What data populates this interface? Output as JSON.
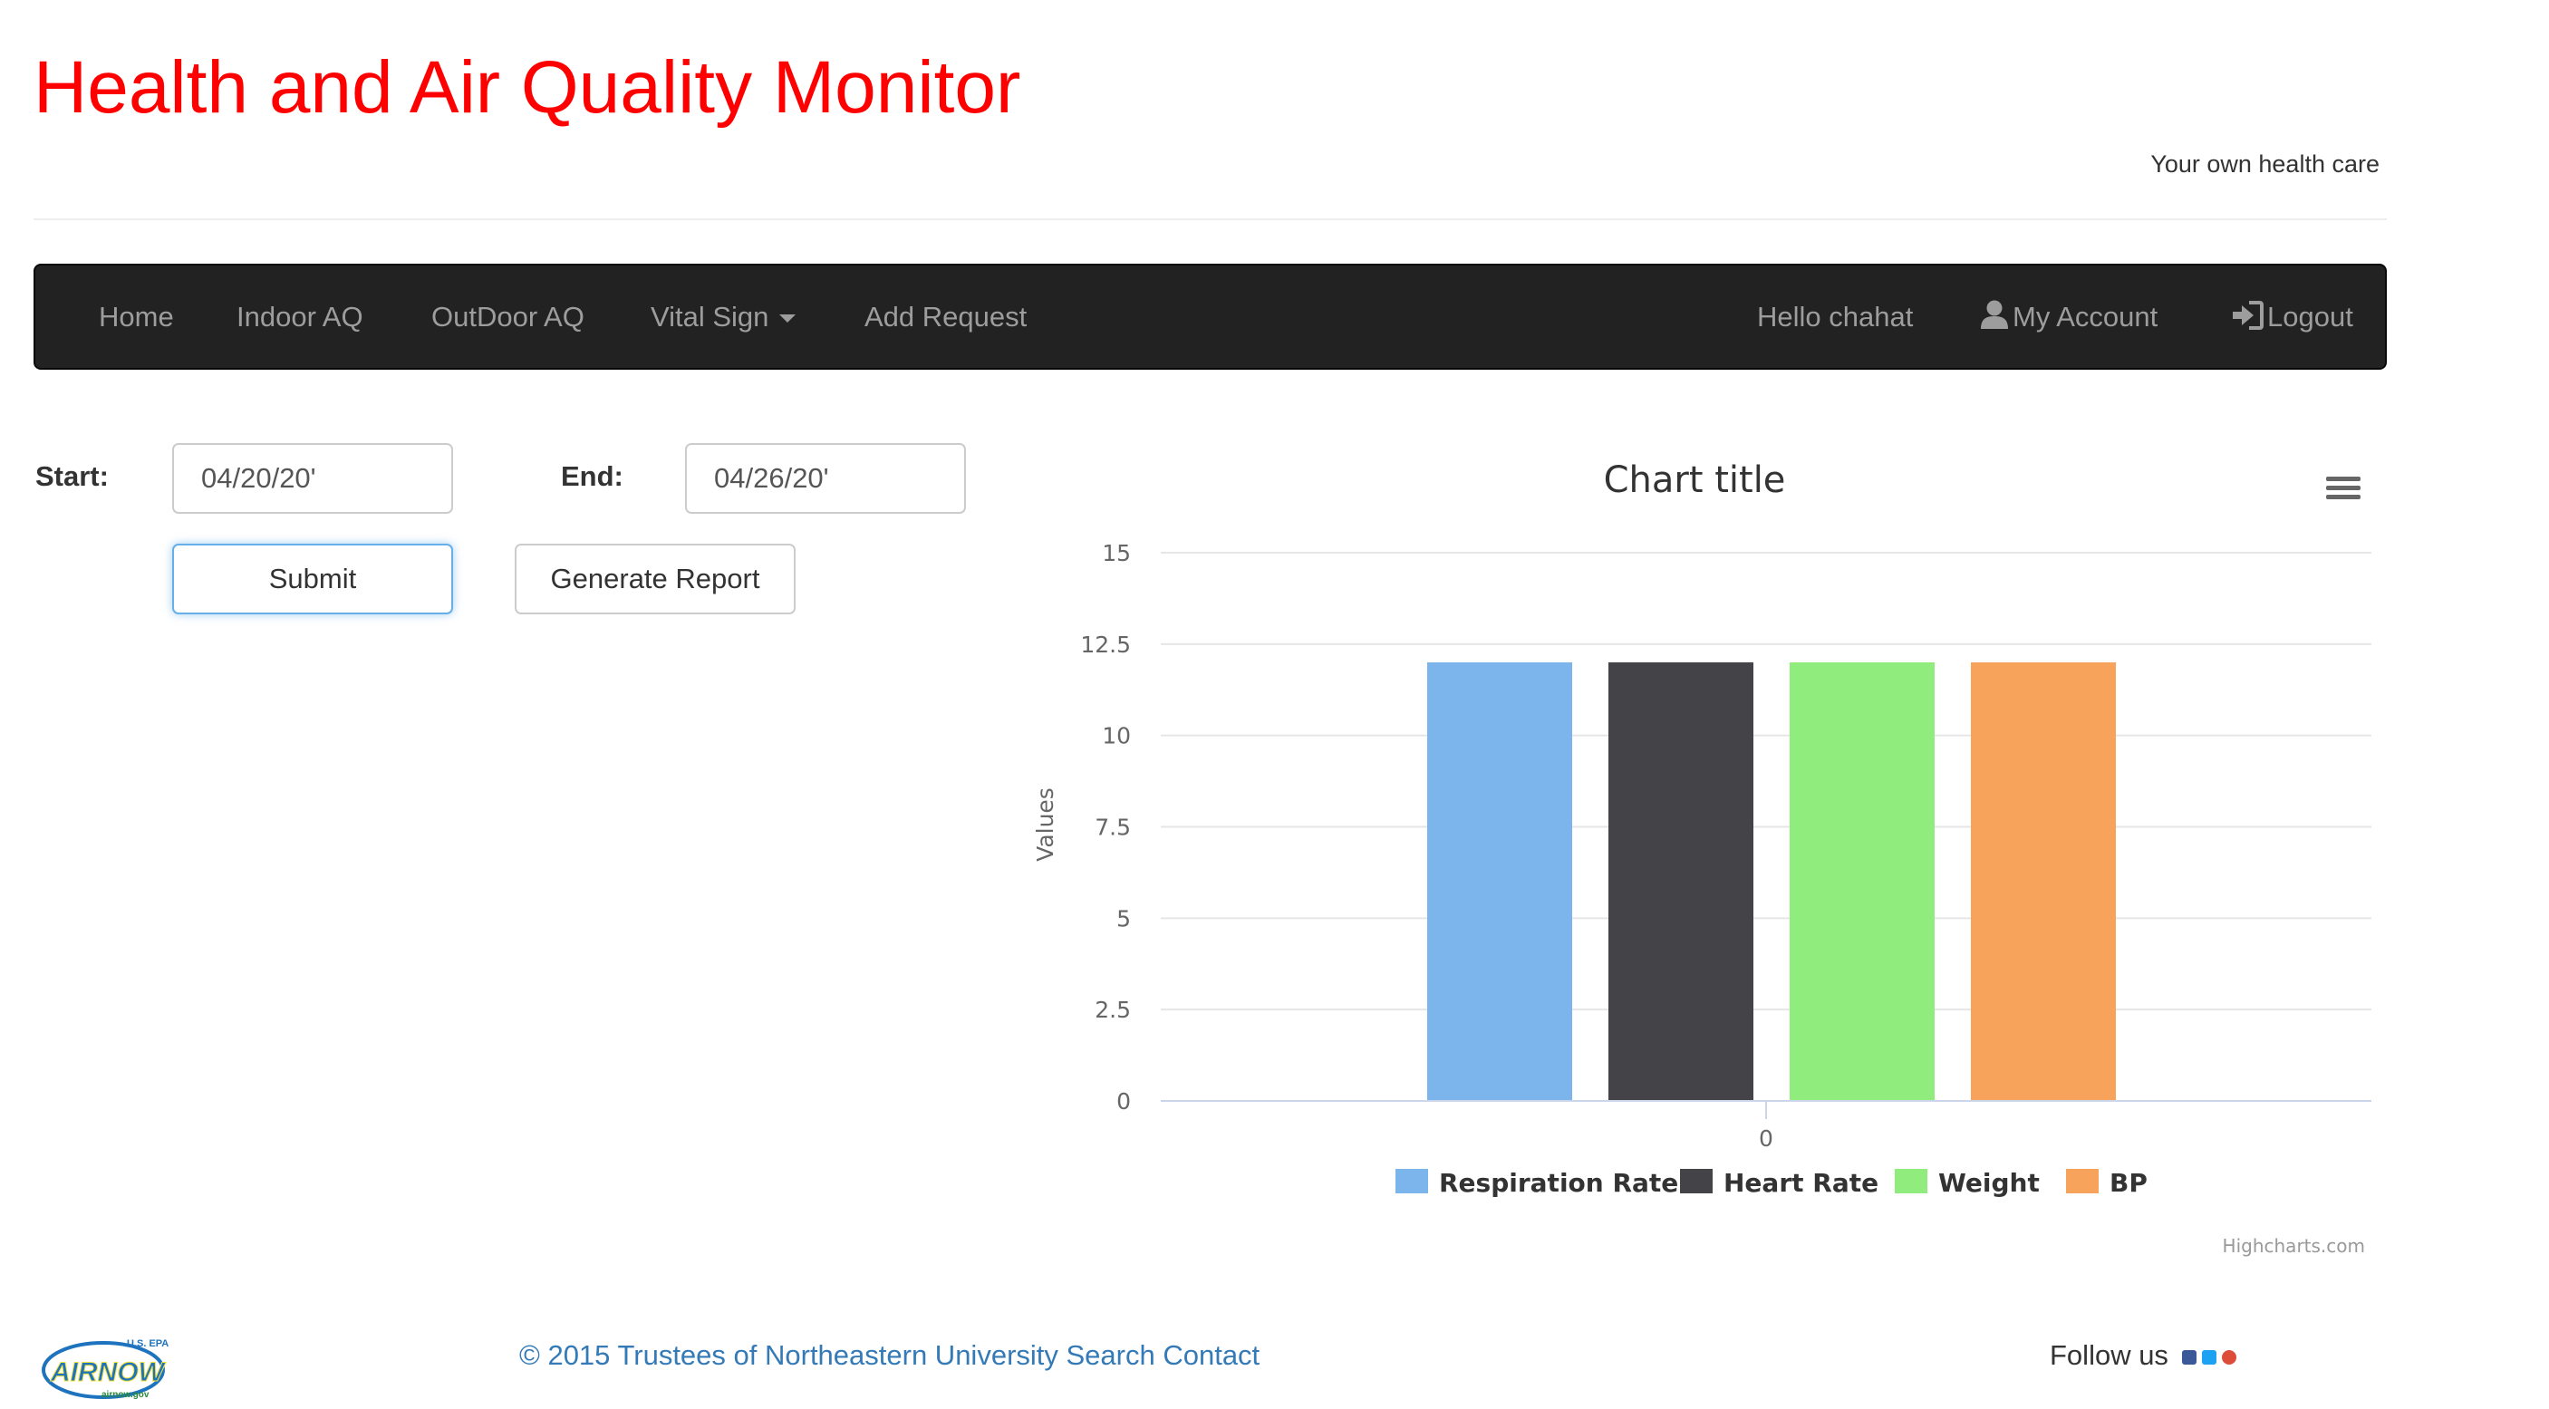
{
  "header": {
    "title": "Health and Air Quality Monitor",
    "tagline": "Your own health care"
  },
  "navbar": {
    "items": [
      {
        "label": "Home"
      },
      {
        "label": "Indoor AQ"
      },
      {
        "label": "OutDoor AQ"
      },
      {
        "label": "Vital Sign"
      },
      {
        "label": "Add Request"
      }
    ],
    "greeting": "Hello chahat",
    "account": "My Account",
    "logout": "Logout",
    "icons": {
      "account": "user-icon",
      "logout": "login-arrow-icon",
      "dropdown": "caret-down-icon"
    }
  },
  "form": {
    "start_label": "Start:",
    "start_value": "04/20/20'",
    "end_label": "End:",
    "end_value": "04/26/20'",
    "submit_label": "Submit",
    "report_label": "Generate Report"
  },
  "chart_data": {
    "type": "bar",
    "title": "Chart title",
    "xlabel": "",
    "ylabel": "Values",
    "categories": [
      "0"
    ],
    "ylim": [
      0,
      15
    ],
    "yticks": [
      "0",
      "2.5",
      "5",
      "7.5",
      "10",
      "12.5",
      "15"
    ],
    "grid": true,
    "legend_position": "bottom",
    "series": [
      {
        "name": "Respiration Rate",
        "values": [
          12
        ],
        "color": "#7cb5ec"
      },
      {
        "name": "Heart Rate",
        "values": [
          12
        ],
        "color": "#434348"
      },
      {
        "name": "Weight",
        "values": [
          12
        ],
        "color": "#90ed7d"
      },
      {
        "name": "BP",
        "values": [
          12
        ],
        "color": "#f7a35c"
      }
    ],
    "credits": "Highcharts.com",
    "menu_icon": "hamburger-menu-icon"
  },
  "footer": {
    "logo_text": "AIRNOW",
    "logo_agency": "U.S. EPA",
    "logo_url_text": "airnow.gov",
    "copyright": "© 2015 Trustees of Northeastern University Search Contact",
    "follow_label": "Follow us",
    "social_icons": [
      "facebook-icon",
      "twitter-icon",
      "google-plus-icon"
    ],
    "social_colors": [
      "#3b5998",
      "#1da1f2",
      "#dd4b39"
    ]
  }
}
